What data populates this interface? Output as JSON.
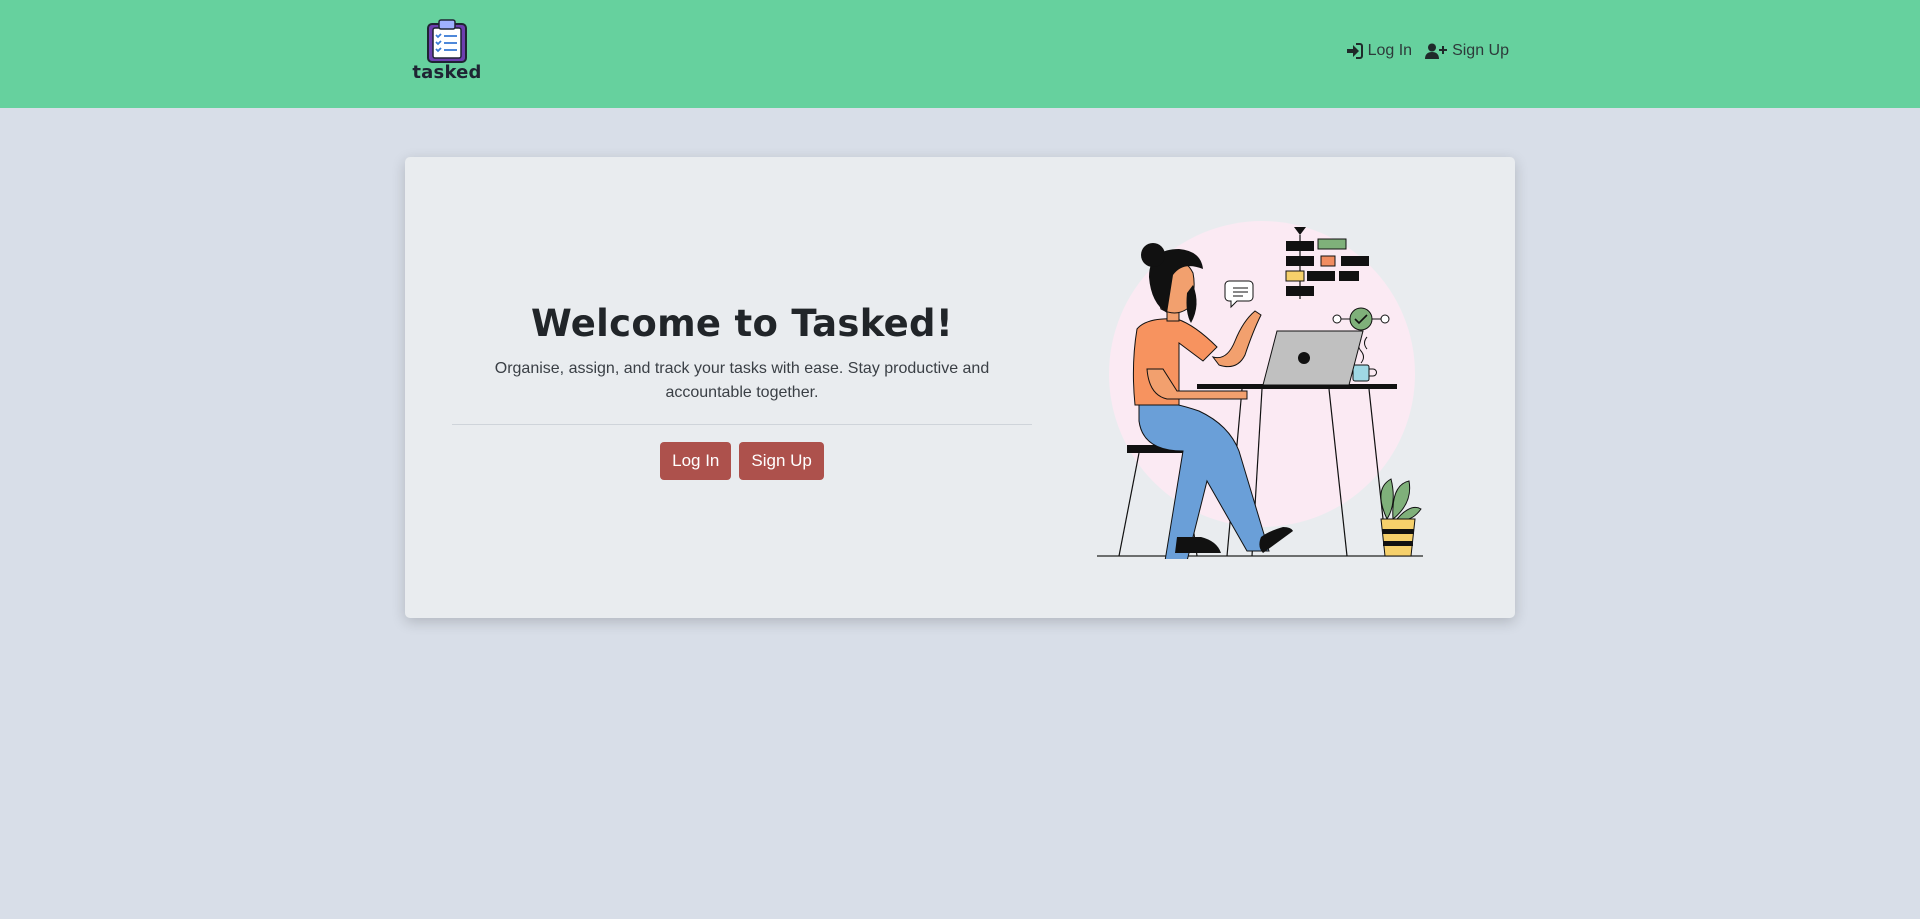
{
  "navbar": {
    "brand": "tasked",
    "links": [
      {
        "label": "Log In",
        "icon": "sign-in-icon"
      },
      {
        "label": "Sign Up",
        "icon": "user-plus-icon"
      }
    ],
    "background": "#66d19e"
  },
  "hero": {
    "title": "Welcome to Tasked!",
    "subtitle": "Organise, assign, and track your tasks with ease. Stay productive and accountable together.",
    "buttons": [
      {
        "label": "Log In"
      },
      {
        "label": "Sign Up"
      }
    ],
    "button_color": "#ad514c"
  },
  "illustration": {
    "description_icon": "woman-at-laptop-illustration"
  }
}
